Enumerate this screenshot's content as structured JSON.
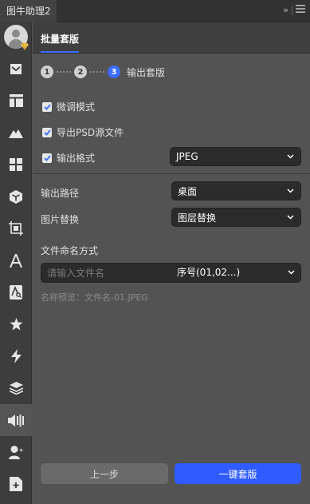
{
  "window": {
    "tab_title": "图牛助理2",
    "expand_glyph": "»",
    "menu_icon": "hamburger-icon"
  },
  "sidebar": {
    "items": [
      {
        "icon": "avatar-icon"
      },
      {
        "icon": "inbox-icon"
      },
      {
        "icon": "layout-icon"
      },
      {
        "icon": "mountain-icon"
      },
      {
        "icon": "grid-icon"
      },
      {
        "icon": "cube-icon"
      },
      {
        "icon": "frame-crop-icon"
      },
      {
        "icon": "text-a-icon"
      },
      {
        "icon": "font-search-icon"
      },
      {
        "icon": "star-icon"
      },
      {
        "icon": "lightning-icon"
      },
      {
        "icon": "layers-icon"
      },
      {
        "icon": "batch-template-icon",
        "active": true
      },
      {
        "icon": "user-sparkle-icon"
      },
      {
        "icon": "add-document-icon"
      }
    ]
  },
  "header": {
    "title": "批量套版"
  },
  "steps": {
    "items": [
      "1",
      "2",
      "3"
    ],
    "active_index": 2,
    "current_label": "输出套版"
  },
  "options": {
    "fine_tune": {
      "label": "微调模式",
      "checked": true
    },
    "export_psd": {
      "label": "导出PSD源文件",
      "checked": true
    },
    "output_format": {
      "label": "输出格式",
      "checked": true,
      "value": "JPEG"
    }
  },
  "output_path": {
    "label": "输出路径",
    "value": "桌面"
  },
  "image_replace": {
    "label": "图片替换",
    "value": "图层替换"
  },
  "naming": {
    "label": "文件命名方式",
    "placeholder": "请输入文件名",
    "mode_value": "序号(01,02...)",
    "preview": "名称预览：文件名-01.JPEG"
  },
  "actions": {
    "prev_label": "上一步",
    "apply_label": "一键套版"
  },
  "colors": {
    "accent": "#2f5bff",
    "panel_bg": "#535353",
    "sidebar_bg": "#3d3d3d",
    "input_bg": "#2b2b2b"
  }
}
